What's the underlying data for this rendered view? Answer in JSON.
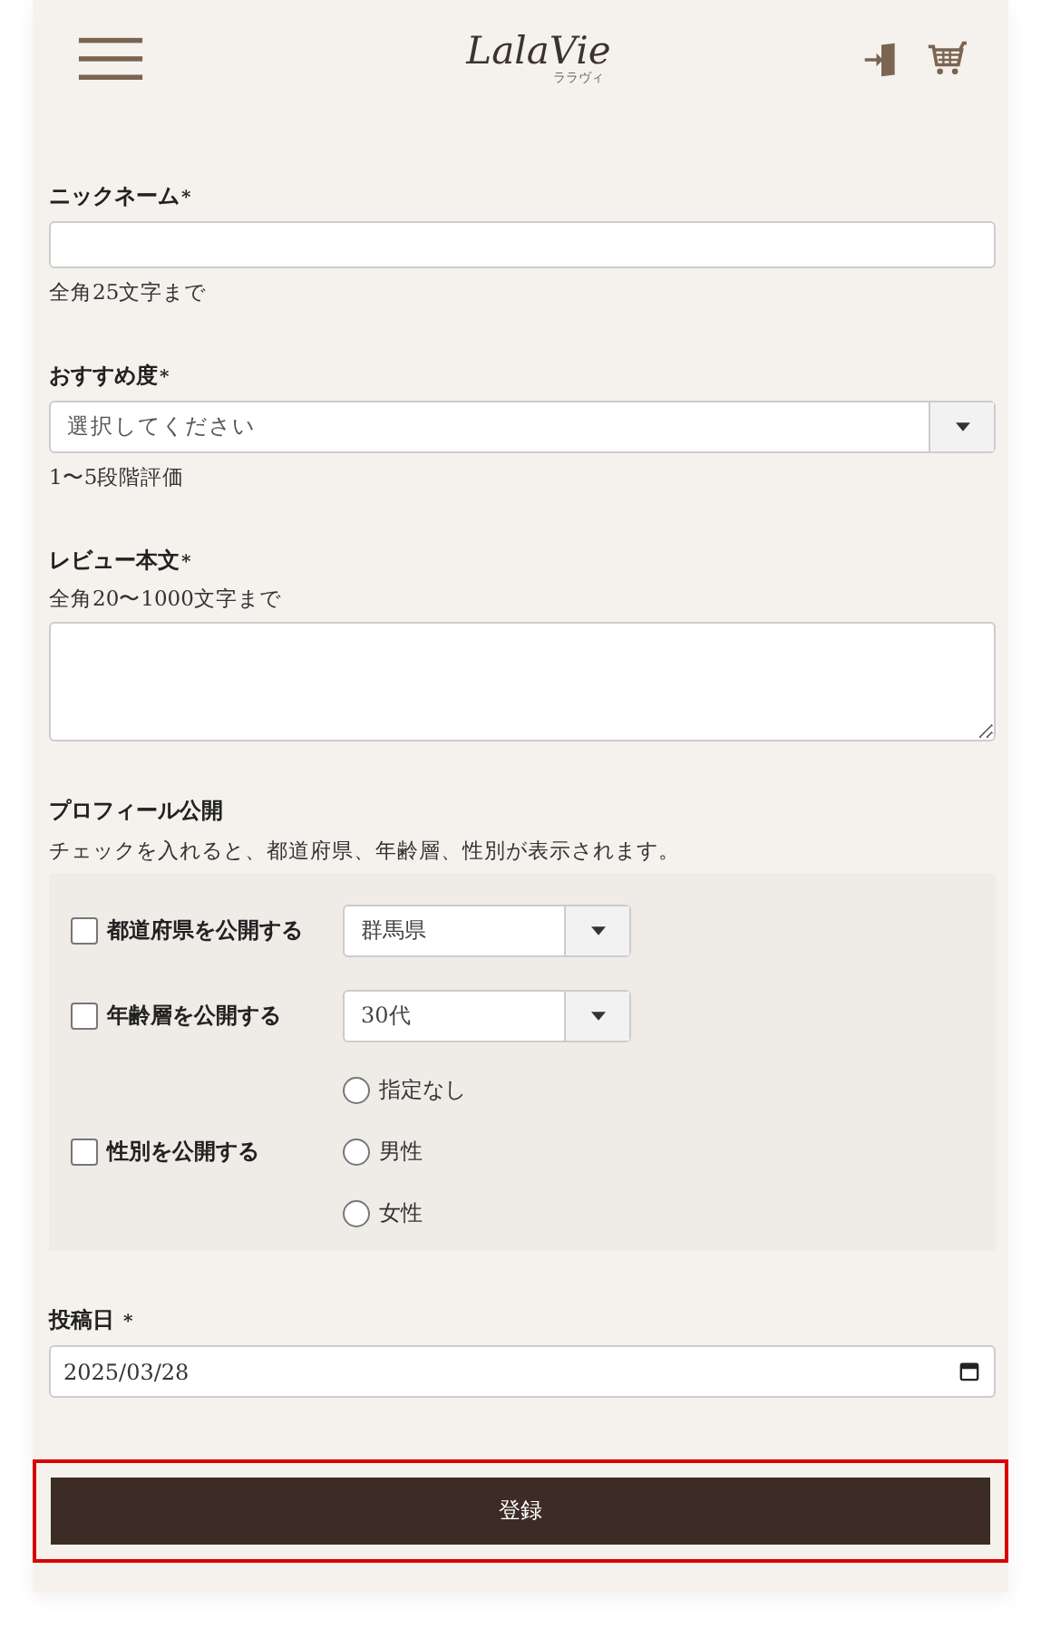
{
  "header": {
    "logo": "LalaVie",
    "logo_sub": "ララヴィ"
  },
  "nickname": {
    "label": "ニックネーム",
    "mark": "*",
    "hint": "全角25文字まで"
  },
  "rating": {
    "label": "おすすめ度",
    "mark": "*",
    "placeholder": "選択してください",
    "hint": "1〜5段階評価"
  },
  "review": {
    "label": "レビュー本文",
    "mark": "*",
    "hint": "全角20〜1000文字まで"
  },
  "profile": {
    "title": "プロフィール公開",
    "description": "チェックを入れると、都道府県、年齢層、性別が表示されます。",
    "rows": [
      {
        "kind": "select",
        "label": "都道府県を公開する",
        "checked": false,
        "value": "群馬県"
      },
      {
        "kind": "select",
        "label": "年齢層を公開する",
        "checked": false,
        "value": "30代"
      },
      {
        "kind": "radio",
        "label": "性別を公開する",
        "checked": false,
        "options": [
          {
            "label": "指定なし",
            "selected": false
          },
          {
            "label": "男性",
            "selected": false
          },
          {
            "label": "女性",
            "selected": false
          }
        ]
      }
    ]
  },
  "post_date": {
    "label": "投稿日",
    "mark": "*",
    "value": "2025/03/28"
  },
  "submit": {
    "label": "登録",
    "highlighted": true
  }
}
